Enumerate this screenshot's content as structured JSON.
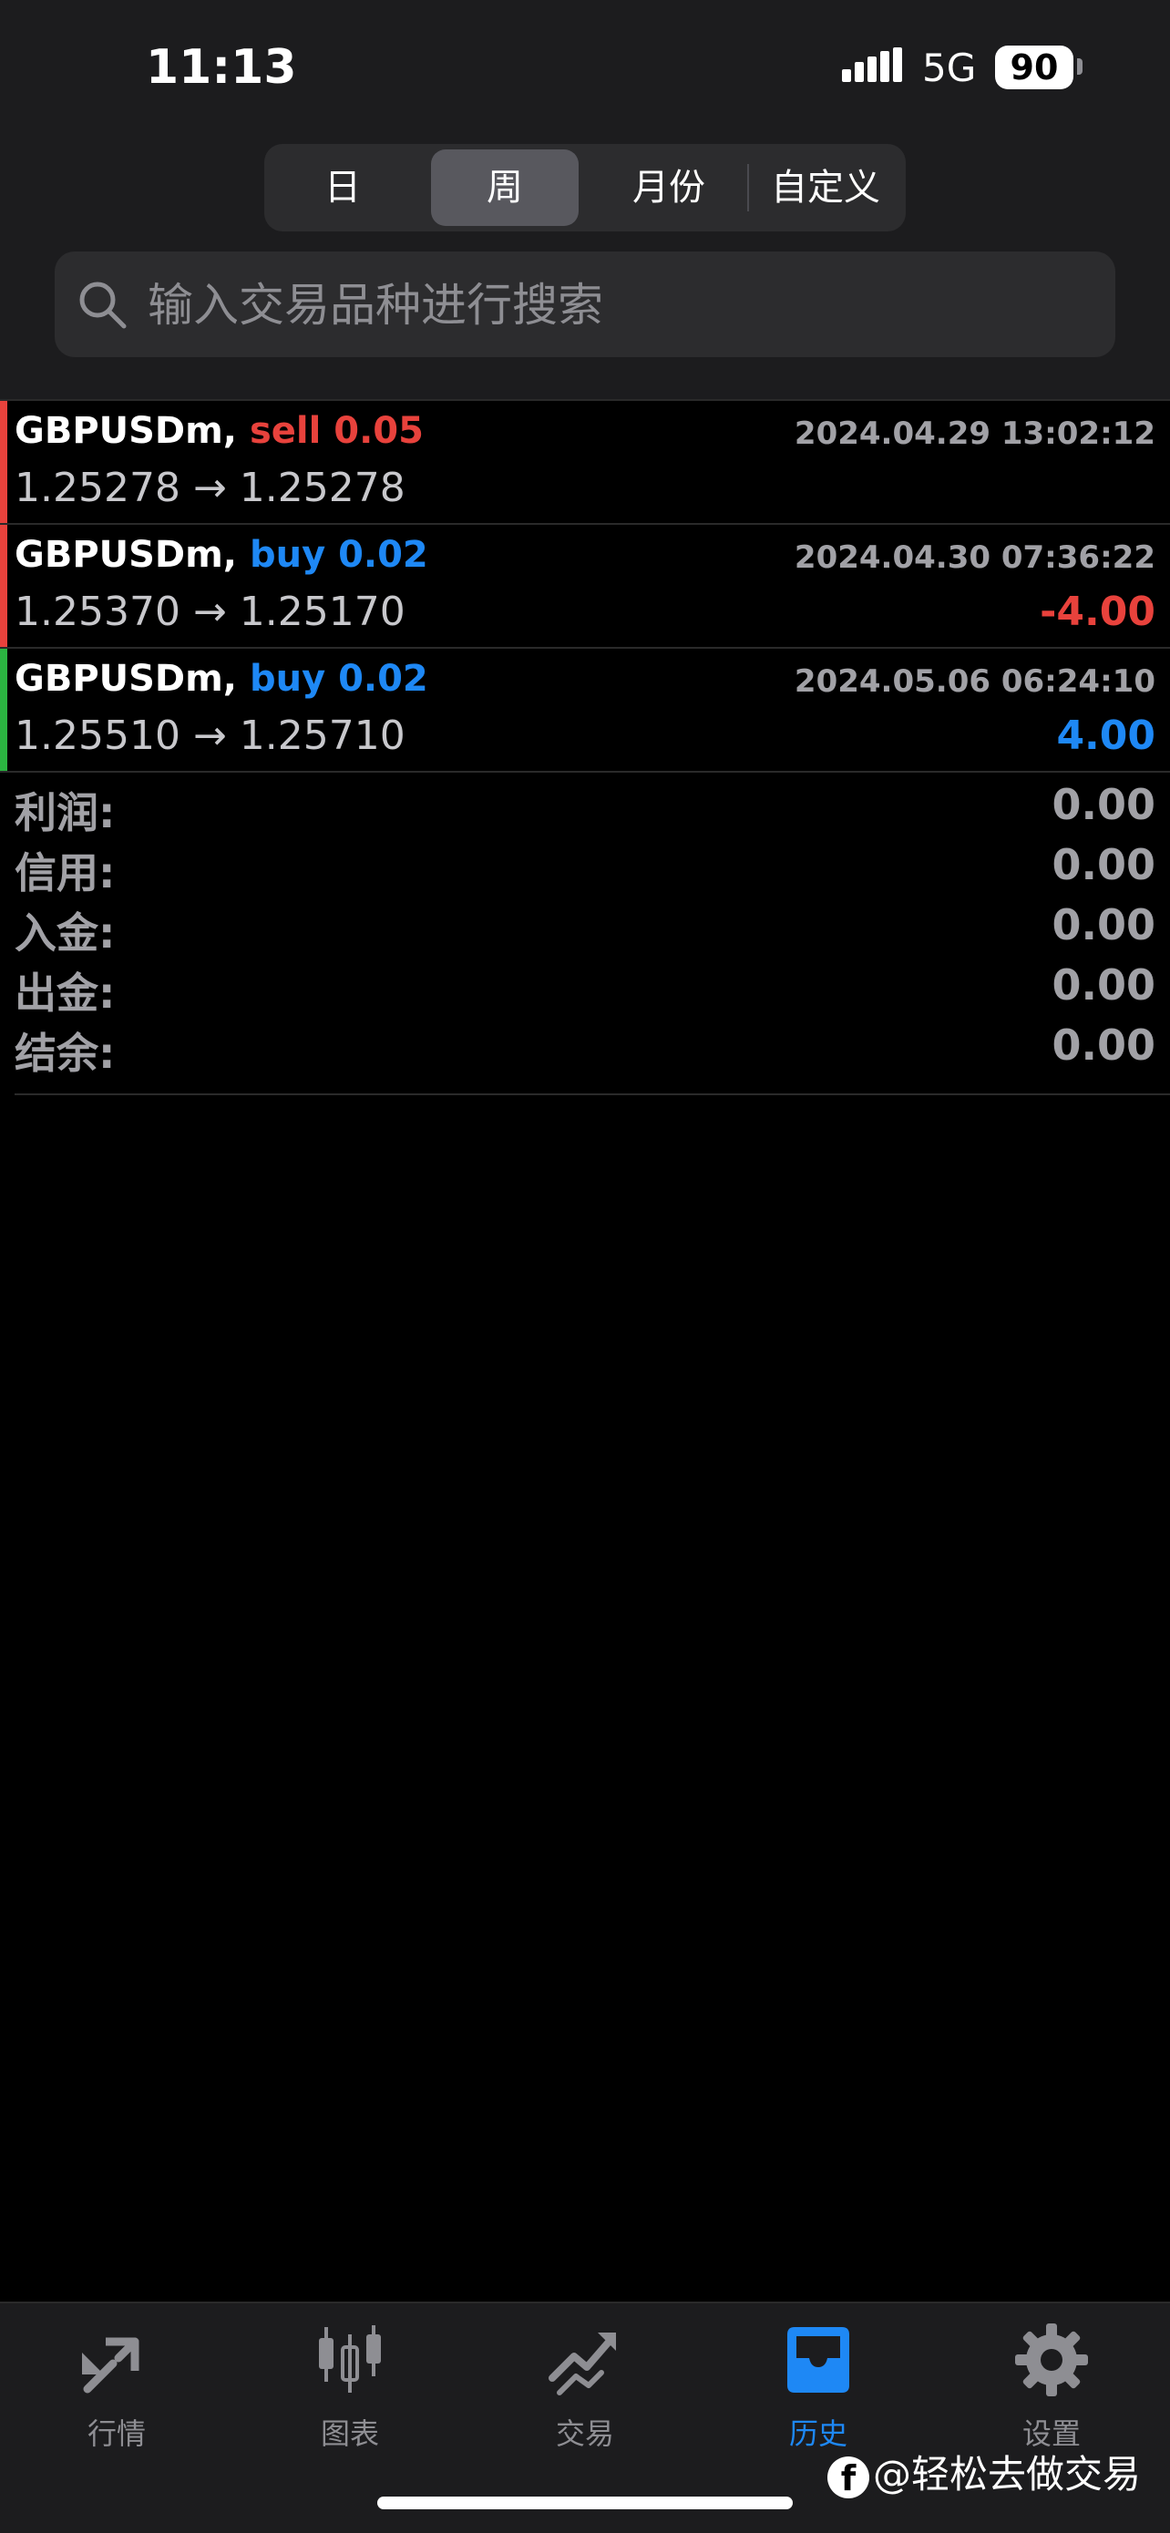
{
  "status_bar": {
    "time": "11:13",
    "network": "5G",
    "battery": "90"
  },
  "period_tabs": [
    {
      "label": "日",
      "active": false
    },
    {
      "label": "周",
      "active": true
    },
    {
      "label": "月份",
      "active": false
    },
    {
      "label": "自定义",
      "active": false
    }
  ],
  "search": {
    "placeholder": "输入交易品种进行搜索"
  },
  "orders": [
    {
      "symbol": "GBPUSDm,",
      "side": "sell 0.05",
      "side_color": "#e8423c",
      "bar_color": "#e8423c",
      "time": "2024.04.29 13:02:12",
      "prices": "1.25278 → 1.25278",
      "profit": "",
      "profit_color": "#e8423c"
    },
    {
      "symbol": "GBPUSDm,",
      "side": "buy 0.02",
      "side_color": "#1e88f5",
      "bar_color": "#e8423c",
      "time": "2024.04.30 07:36:22",
      "prices": "1.25370 → 1.25170",
      "profit": "-4.00",
      "profit_color": "#e8423c"
    },
    {
      "symbol": "GBPUSDm,",
      "side": "buy 0.02",
      "side_color": "#1e88f5",
      "bar_color": "#2bb541",
      "time": "2024.05.06 06:24:10",
      "prices": "1.25510 → 1.25710",
      "profit": "4.00",
      "profit_color": "#1e88f5"
    }
  ],
  "summary": [
    {
      "label": "利润:",
      "value": "0.00"
    },
    {
      "label": "信用:",
      "value": "0.00"
    },
    {
      "label": "入金:",
      "value": "0.00"
    },
    {
      "label": "出金:",
      "value": "0.00"
    },
    {
      "label": "结余:",
      "value": "0.00"
    }
  ],
  "tabbar": [
    {
      "label": "行情",
      "icon": "quotes-icon",
      "active": false
    },
    {
      "label": "图表",
      "icon": "candlestick-chart-icon",
      "active": false
    },
    {
      "label": "交易",
      "icon": "trade-icon",
      "active": false
    },
    {
      "label": "历史",
      "icon": "history-inbox-icon",
      "active": true
    },
    {
      "label": "设置",
      "icon": "gear-icon",
      "active": false
    }
  ],
  "watermark": "@轻松去做交易",
  "colors": {
    "accent": "#1e88f5",
    "loss": "#e8423c",
    "gain": "#2bb541",
    "muted": "#a1a1a6"
  }
}
